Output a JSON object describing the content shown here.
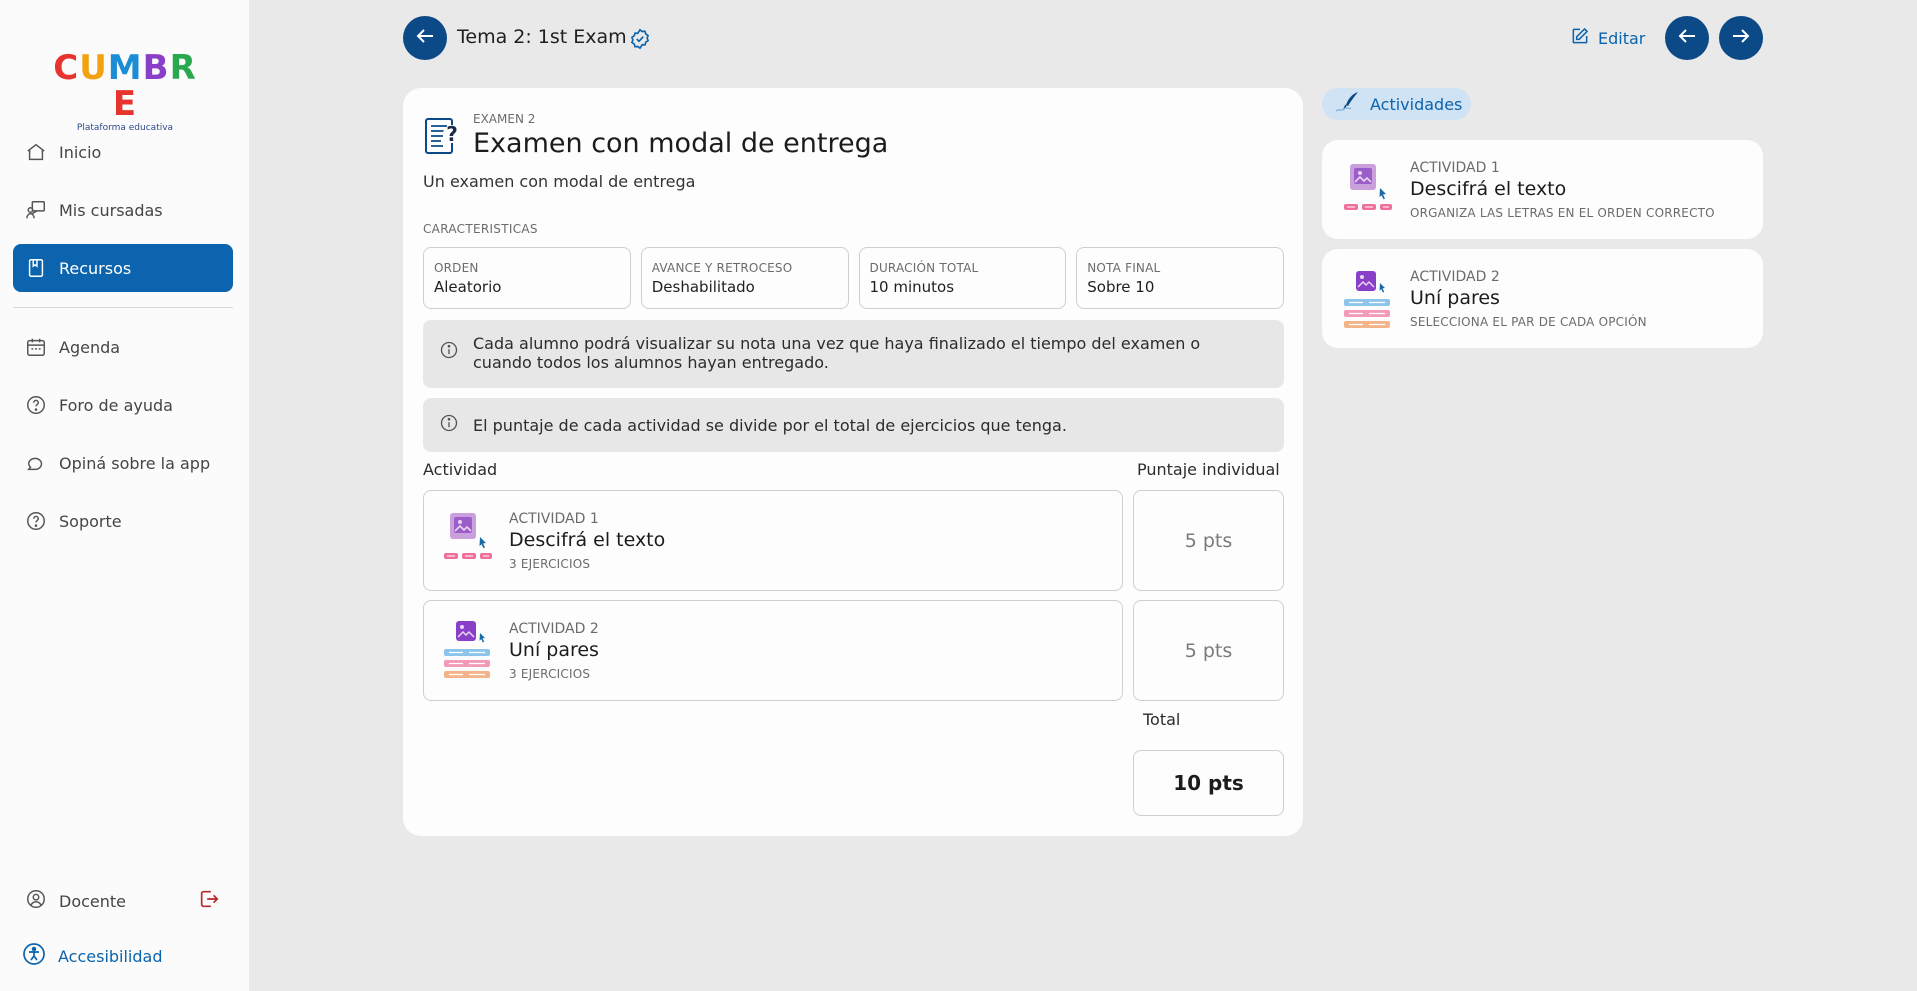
{
  "sidebar": {
    "logo": {
      "text": "CUMBRE",
      "subtitle": "Plataforma educativa"
    },
    "items": [
      {
        "label": "Inicio",
        "icon": "home-icon",
        "active": false
      },
      {
        "label": "Mis cursadas",
        "icon": "teacher-board-icon",
        "active": false
      },
      {
        "label": "Recursos",
        "icon": "book-icon",
        "active": true
      }
    ],
    "items2": [
      {
        "label": "Agenda",
        "icon": "calendar-icon"
      },
      {
        "label": "Foro de ayuda",
        "icon": "question-circle-icon"
      },
      {
        "label": "Opiná sobre la app",
        "icon": "chat-bubbles-icon"
      },
      {
        "label": "Soporte",
        "icon": "question-circle-icon"
      }
    ],
    "user": {
      "label": "Docente",
      "logout_icon": "logout-icon"
    },
    "accessibility": {
      "label": "Accesibilidad"
    }
  },
  "header": {
    "title": "Tema 2: 1st Exam",
    "edit_label": "Editar"
  },
  "exam": {
    "kicker": "EXAMEN 2",
    "title": "Examen con modal de entrega",
    "description": "Un examen con modal de entrega",
    "characteristics_label": "CARACTERISTICAS",
    "characteristics": [
      {
        "key": "ORDEN",
        "value": "Aleatorio"
      },
      {
        "key": "AVANCE Y RETROCESO",
        "value": "Deshabilitado"
      },
      {
        "key": "DURACIÓN TOTAL",
        "value": "10 minutos"
      },
      {
        "key": "NOTA FINAL",
        "value": "Sobre 10"
      }
    ],
    "info_1": "Cada alumno podrá visualizar su nota una vez que haya finalizado el tiempo del examen o cuando todos los alumnos hayan entregado.",
    "info_2": "El puntaje de cada actividad se divide por el total de ejercicios que tenga.",
    "col_activity": "Actividad",
    "col_score": "Puntaje individual",
    "activities": [
      {
        "kicker": "ACTIVIDAD 1",
        "title": "Descifrá el texto",
        "exercises": "3 EJERCICIOS",
        "points": "5 pts"
      },
      {
        "kicker": "ACTIVIDAD 2",
        "title": "Uní pares",
        "exercises": "3 EJERCICIOS",
        "points": "5 pts"
      }
    ],
    "total_label": "Total",
    "total_value": "10 pts"
  },
  "panel": {
    "chip_label": "Actividades",
    "cards": [
      {
        "kicker": "ACTIVIDAD 1",
        "title": "Descifrá el texto",
        "subtitle": "ORGANIZA LAS LETRAS EN EL ORDEN CORRECTO"
      },
      {
        "kicker": "ACTIVIDAD 2",
        "title": "Uní pares",
        "subtitle": "SELECCIONA EL PAR DE CADA OPCIÓN"
      }
    ]
  },
  "colors": {
    "primary": "#0b64ad",
    "dark_button": "#0b4a87",
    "background": "#e9e9e9"
  }
}
